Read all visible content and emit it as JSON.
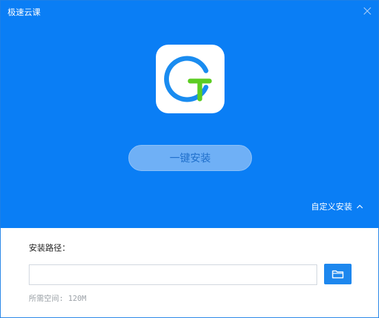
{
  "window": {
    "title": "极速云课",
    "accent_color": "#0a7ef5"
  },
  "header": {
    "logo_icon": "app-logo-icon",
    "install_button_label": "一键安装",
    "custom_install_label": "自定义安装",
    "custom_install_icon": "chevron-up-icon",
    "close_icon": "close-icon"
  },
  "install_path": {
    "label": "安装路径：",
    "value": "",
    "browse_icon": "folder-icon"
  },
  "space": {
    "required_text": "所需空间: 120M"
  }
}
